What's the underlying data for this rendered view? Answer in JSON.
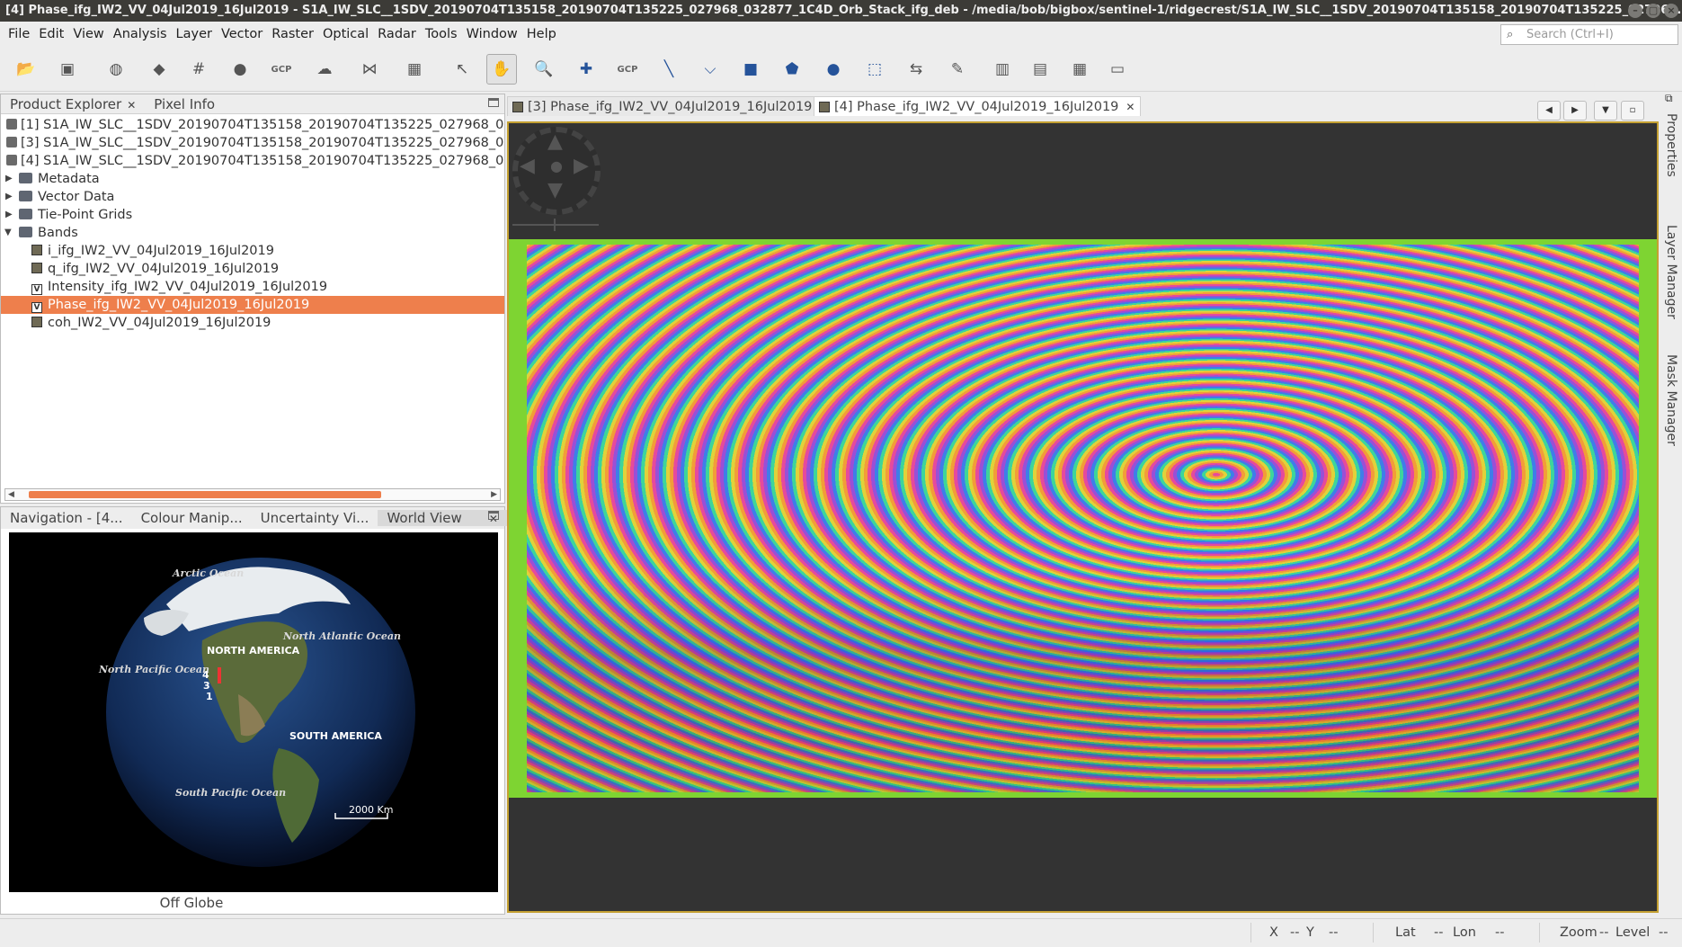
{
  "window": {
    "title": "[4] Phase_ifg_IW2_VV_04Jul2019_16Jul2019 - S1A_IW_SLC__1SDV_20190704T135158_20190704T135225_027968_032877_1C4D_Orb_Stack_ifg_deb - /media/bob/bigbox/sentinel-1/ridgecrest/S1A_IW_SLC__1SDV_20190704T135158_20190704T135225_027968..."
  },
  "menu": [
    "File",
    "Edit",
    "View",
    "Analysis",
    "Layer",
    "Vector",
    "Raster",
    "Optical",
    "Radar",
    "Tools",
    "Window",
    "Help"
  ],
  "search": {
    "placeholder": "Search (Ctrl+I)"
  },
  "toolbar": {
    "gcp1": "GCP",
    "gcp2": "GCP"
  },
  "left_tabs": {
    "product_explorer": "Product Explorer",
    "pixel_info": "Pixel Info"
  },
  "tree": {
    "products": [
      "[1] S1A_IW_SLC__1SDV_20190704T135158_20190704T135225_027968_032877_",
      "[3] S1A_IW_SLC__1SDV_20190704T135158_20190704T135225_027968_032877_",
      "[4] S1A_IW_SLC__1SDV_20190704T135158_20190704T135225_027968_032877_"
    ],
    "folders": [
      "Metadata",
      "Vector Data",
      "Tie-Point Grids",
      "Bands"
    ],
    "bands": [
      "i_ifg_IW2_VV_04Jul2019_16Jul2019",
      "q_ifg_IW2_VV_04Jul2019_16Jul2019",
      "Intensity_ifg_IW2_VV_04Jul2019_16Jul2019",
      "Phase_ifg_IW2_VV_04Jul2019_16Jul2019",
      "coh_IW2_VV_04Jul2019_16Jul2019"
    ],
    "selected_band": "Phase_ifg_IW2_VV_04Jul2019_16Jul2019"
  },
  "bottom_tabs": [
    "Navigation - [4...",
    "Colour Manip...",
    "Uncertainty Vi...",
    "World View"
  ],
  "world_view": {
    "labels": {
      "arctic": "Arctic Ocean",
      "north_atlantic": "North Atlantic Ocean",
      "north_america": "NORTH AMERICA",
      "north_pacific": "North Pacific Ocean",
      "south_america": "SOUTH AMERICA",
      "south_pacific": "South Pacific Ocean",
      "m4": "4",
      "m3": "3",
      "m1": "1"
    },
    "scale": "2000 Km",
    "off_globe": "Off Globe"
  },
  "image_tabs": [
    {
      "label": "[3] Phase_ifg_IW2_VV_04Jul2019_16Jul2019"
    },
    {
      "label": "[4] Phase_ifg_IW2_VV_04Jul2019_16Jul2019"
    }
  ],
  "right_tabs": [
    "Properties",
    "Layer Manager",
    "Mask Manager"
  ],
  "status": {
    "x_label": "X",
    "x_val": "--",
    "y_label": "Y",
    "y_val": "--",
    "lat_label": "Lat",
    "lat_val": "--",
    "lon_label": "Lon",
    "lon_val": "--",
    "zoom_label": "Zoom",
    "zoom_val": "--",
    "level_label": "Level",
    "level_val": "--"
  },
  "colors": {
    "selection": "#ee7f4c",
    "view_border": "#c4a032",
    "image_bg": "#7ed432"
  }
}
